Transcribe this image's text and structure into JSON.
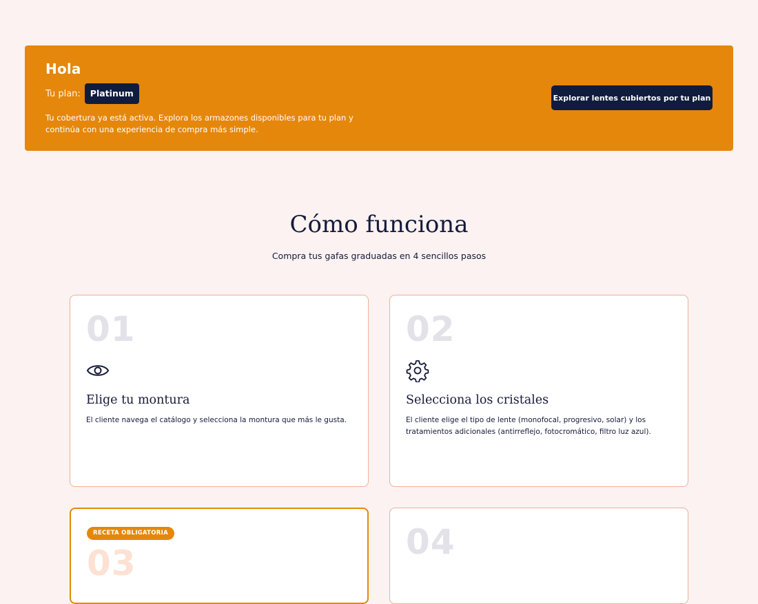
{
  "banner": {
    "greeting": "Hola",
    "plan_label": "Tu plan:",
    "plan_name": "Platinum",
    "description": "Tu cobertura ya está activa. Explora los armazones disponibles para tu plan y continúa con una experiencia de compra más simple.",
    "cta_label": "Explorar lentes cubiertos por tu plan"
  },
  "section": {
    "title": "Cómo funciona",
    "subtitle": "Compra tus gafas graduadas en 4 sencillos pasos"
  },
  "steps": [
    {
      "number": "01",
      "icon": "eye-icon",
      "title": "Elige tu montura",
      "text": "El cliente navega el catálogo y selecciona la montura que más le gusta."
    },
    {
      "number": "02",
      "icon": "gear-icon",
      "title": "Selecciona los cristales",
      "text": "El cliente elige el tipo de lente (monofocal, progresivo, solar) y los tratamientos adicionales (antirreflejo, fotocromático, filtro luz azul)."
    },
    {
      "number": "03",
      "tag": "RECETA OBLIGATORIA"
    },
    {
      "number": "04"
    }
  ],
  "colors": {
    "accent": "#e5870b",
    "navy": "#101c3e",
    "background": "#fbf2f1",
    "card_border": "#efb094"
  }
}
